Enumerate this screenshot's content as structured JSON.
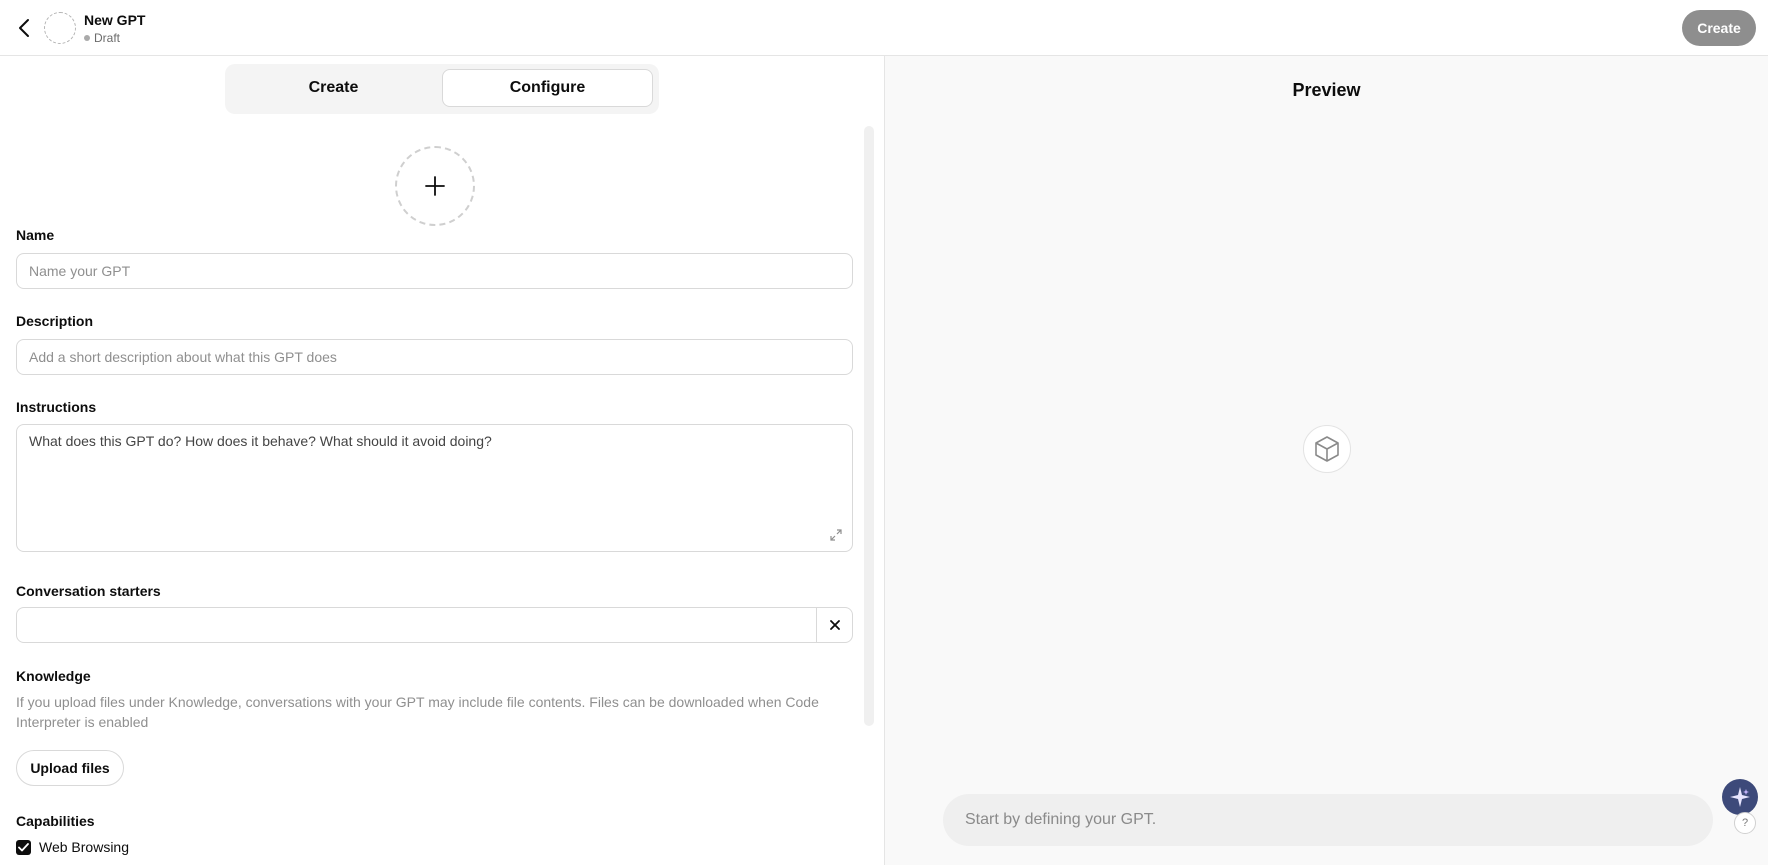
{
  "header": {
    "back_icon": "chevron-left-icon",
    "title": "New GPT",
    "status": "Draft",
    "create_label": "Create"
  },
  "tabs": [
    {
      "label": "Create",
      "active": false
    },
    {
      "label": "Configure",
      "active": true
    }
  ],
  "form": {
    "avatar_icon": "plus-icon",
    "name_label": "Name",
    "name_placeholder": "Name your GPT",
    "description_label": "Description",
    "description_placeholder": "Add a short description about what this GPT does",
    "instructions_label": "Instructions",
    "instructions_placeholder": "What does this GPT do? How does it behave? What should it avoid doing?",
    "starters_label": "Conversation starters",
    "starters_value": "",
    "knowledge_label": "Knowledge",
    "knowledge_help": "If you upload files under Knowledge, conversations with your GPT may include file contents. Files can be downloaded when Code Interpreter is enabled",
    "upload_label": "Upload files",
    "capabilities_label": "Capabilities",
    "capabilities": [
      {
        "label": "Web Browsing",
        "checked": true
      }
    ]
  },
  "preview": {
    "title": "Preview",
    "logo_icon": "cube-icon",
    "input_placeholder": "Start by defining your GPT."
  },
  "floating": {
    "assistant_icon": "sparkle-icon",
    "help_label": "?"
  },
  "colors": {
    "create_button_bg": "#8e8e8e",
    "checkbox": "#0d0d0d",
    "preview_bg": "#f9f9f9"
  }
}
